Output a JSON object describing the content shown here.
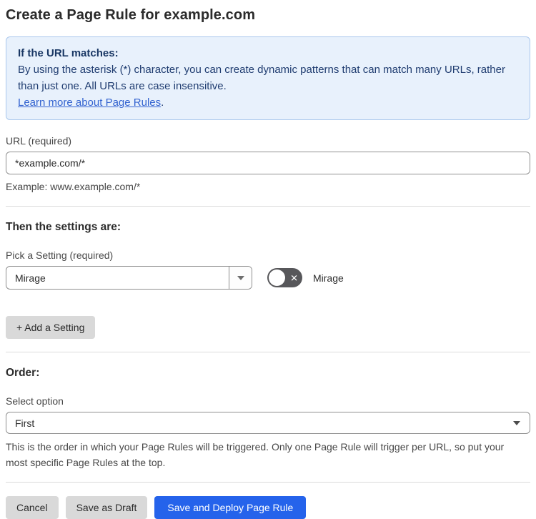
{
  "page": {
    "title": "Create a Page Rule for example.com"
  },
  "info_box": {
    "heading": "If the URL matches:",
    "body": "By using the asterisk (*) character, you can create dynamic patterns that can match many URLs, rather than just one. All URLs are case insensitive.",
    "link_label": "Learn more about Page Rules",
    "link_suffix": "."
  },
  "url_field": {
    "label": "URL (required)",
    "value": "*example.com/*",
    "helper": "Example: www.example.com/*"
  },
  "settings_section": {
    "heading": "Then the settings are:",
    "picker_label": "Pick a Setting (required)",
    "selected_setting": "Mirage",
    "toggle_label": "Mirage",
    "toggle_state": "off",
    "toggle_x_glyph": "✕",
    "add_setting_button": "+ Add a Setting"
  },
  "order_section": {
    "heading": "Order:",
    "select_label": "Select option",
    "selected_option": "First",
    "helper": "This is the order in which your Page Rules will be triggered. Only one Page Rule will trigger per URL, so put your most specific Page Rules at the top."
  },
  "footer": {
    "cancel_label": "Cancel",
    "save_draft_label": "Save as Draft",
    "save_deploy_label": "Save and Deploy Page Rule"
  },
  "colors": {
    "info_background": "#e8f1fc",
    "info_border": "#aac8ed",
    "info_text": "#1f3c70",
    "link": "#3363d0",
    "primary_button": "#2563eb",
    "secondary_button": "#d9d9d9",
    "toggle_off": "#57575a",
    "input_border": "#8f8f8f"
  }
}
